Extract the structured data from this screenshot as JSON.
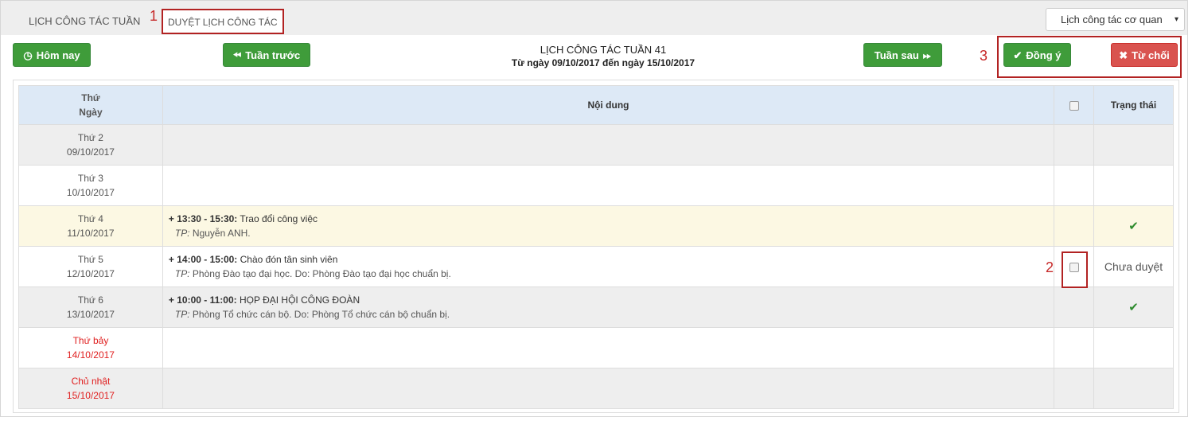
{
  "tabs": {
    "week": "LỊCH CÔNG TÁC TUẦN",
    "approve": "DUYỆT LỊCH CÔNG TÁC"
  },
  "markers": {
    "m1": "1",
    "m2": "2",
    "m3": "3"
  },
  "select": {
    "value": "Lịch công tác cơ quan",
    "caret": "▾"
  },
  "toolbar": {
    "today": "Hôm nay",
    "prev": "Tuần trước",
    "next": "Tuần sau",
    "approve": "Đồng ý",
    "reject": "Từ chối"
  },
  "title": {
    "line1": "LỊCH CÔNG TÁC TUẦN 41",
    "line2": "Từ ngày 09/10/2017 đến ngày 15/10/2017"
  },
  "table": {
    "headers": {
      "day_line1": "Thứ",
      "day_line2": "Ngày",
      "content": "Nội dung",
      "status": "Trạng thái"
    },
    "rows": [
      {
        "day": "Thứ 2",
        "date": "09/10/2017",
        "time": "",
        "subject": "",
        "tp_label": "",
        "tp": "",
        "status": "",
        "approved": false,
        "weekend": false
      },
      {
        "day": "Thứ 3",
        "date": "10/10/2017",
        "time": "",
        "subject": "",
        "tp_label": "",
        "tp": "",
        "status": "",
        "approved": false,
        "weekend": false
      },
      {
        "day": "Thứ 4",
        "date": "11/10/2017",
        "time": "+ 13:30 - 15:30:",
        "subject": " Trao đổi công việc",
        "tp_label": "TP:",
        "tp": " Nguyễn ANH.",
        "status": "",
        "approved": true,
        "weekend": false
      },
      {
        "day": "Thứ 5",
        "date": "12/10/2017",
        "time": "+ 14:00 - 15:00:",
        "subject": " Chào đón tân sinh viên",
        "tp_label": "TP:",
        "tp": " Phòng Đào tạo đại học. Do: Phòng Đào tạo đại học chuẩn bị.",
        "status": "Chưa duyệt",
        "approved": false,
        "weekend": false
      },
      {
        "day": "Thứ 6",
        "date": "13/10/2017",
        "time": "+ 10:00 - 11:00:",
        "subject": " HỌP ĐẠI HỘI CÔNG ĐOÀN",
        "tp_label": "TP:",
        "tp": " Phòng Tổ chức cán bộ. Do: Phòng Tổ chức cán bộ chuẩn bị.",
        "status": "",
        "approved": true,
        "weekend": false
      },
      {
        "day": "Thứ bảy",
        "date": "14/10/2017",
        "time": "",
        "subject": "",
        "tp_label": "",
        "tp": "",
        "status": "",
        "approved": false,
        "weekend": true
      },
      {
        "day": "Chủ nhật",
        "date": "15/10/2017",
        "time": "",
        "subject": "",
        "tp_label": "",
        "tp": "",
        "status": "",
        "approved": false,
        "weekend": true
      }
    ]
  },
  "colors": {
    "accent_green": "#3f9c3a",
    "danger_red": "#d9534f",
    "highlight": "#b22222",
    "weekend": "#e02020"
  }
}
